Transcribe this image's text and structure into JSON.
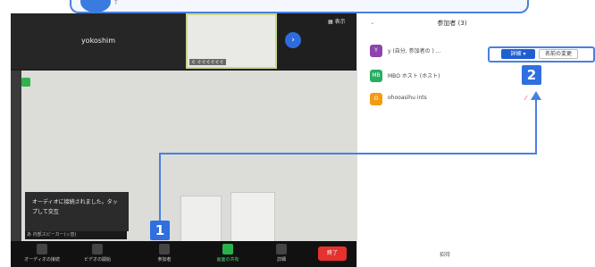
{
  "top_banner": {
    "text": "T"
  },
  "video": {
    "tile_name": "yokoshim",
    "tile2_label": "ぐ ぐぐぐぐぐぐ",
    "view_label": "▦ 表示"
  },
  "audio_popup": {
    "text": "オーディオに接続されました。タップして交互",
    "sub_text": "あ 内部スピーカー(ッ音)"
  },
  "toolbar": {
    "items": [
      {
        "label": "オーディオの接続"
      },
      {
        "label": "ビデオの開始"
      },
      {
        "label": "参加者"
      },
      {
        "label": "画面の共有"
      },
      {
        "label": "詳細"
      }
    ],
    "end_label": "終了"
  },
  "participants_panel": {
    "title": "参加者 (3)",
    "rows": [
      {
        "avatar": "Y",
        "name": "y (自分, 参加者の ) ...",
        "avatar_color": "#8e44ad"
      },
      {
        "avatar": "MB",
        "name": "MBO ホスト (ホスト)",
        "avatar_color": "#27ae60"
      },
      {
        "avatar": "O",
        "name": "ohooasihu ints",
        "avatar_color": "#f39c12"
      }
    ],
    "detail_button": "詳細 ▾",
    "rename_button": "名前の変更",
    "bottom_button": "招待"
  },
  "callouts": {
    "badge_1": "1",
    "badge_2": "2"
  },
  "colors": {
    "accent": "#2f6fe0",
    "end": "#e5322d",
    "share": "#29b24a"
  }
}
